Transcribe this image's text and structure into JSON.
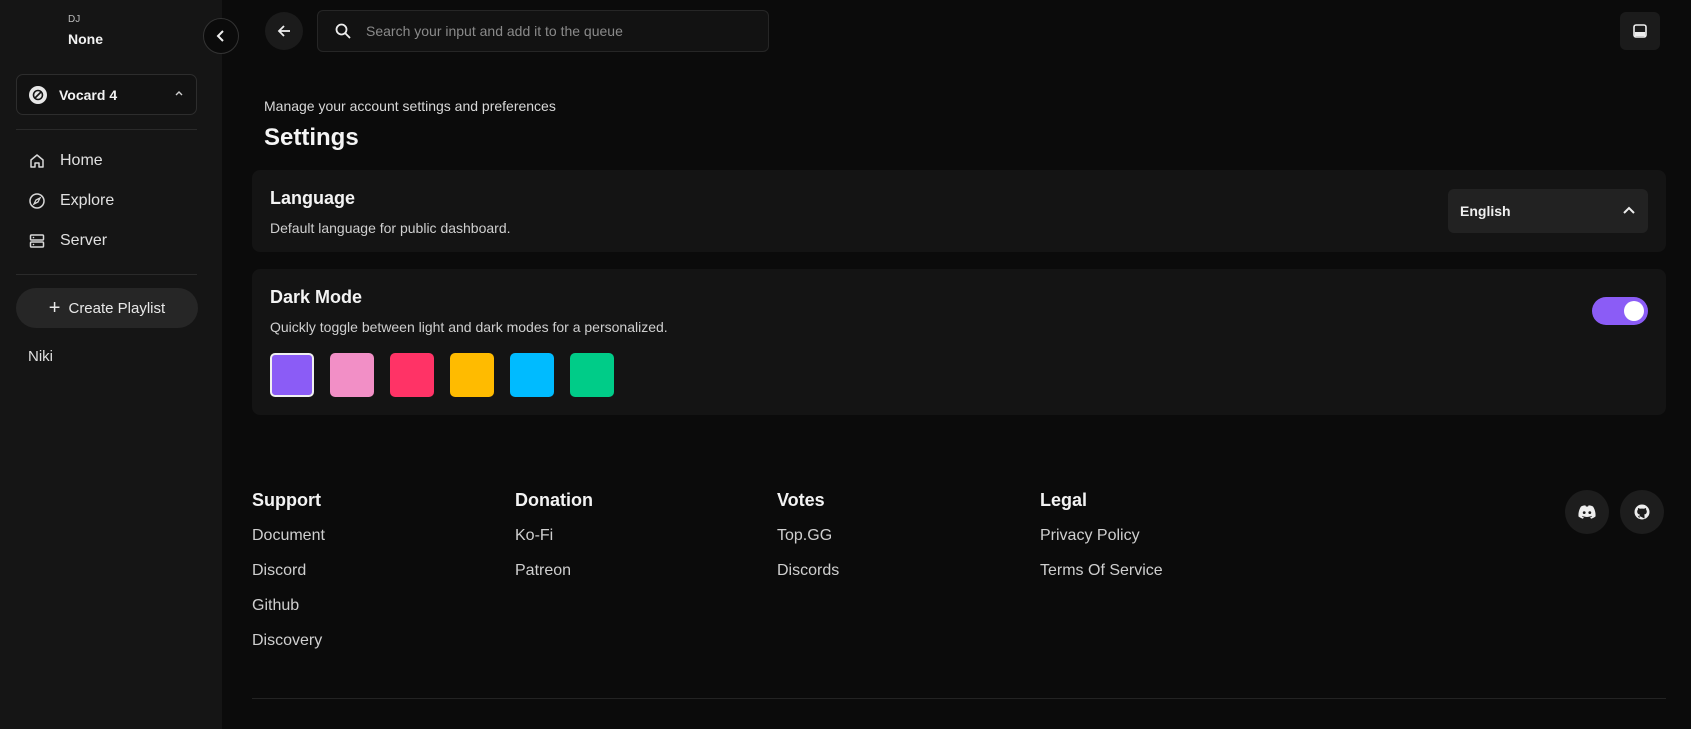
{
  "sidebar": {
    "dj_label": "DJ",
    "dj_value": "None",
    "server_name": "Vocard 4",
    "nav": [
      {
        "label": "Home",
        "icon": "home-icon"
      },
      {
        "label": "Explore",
        "icon": "compass-icon"
      },
      {
        "label": "Server",
        "icon": "server-icon"
      }
    ],
    "create_playlist": "Create Playlist",
    "playlists": [
      "Niki"
    ]
  },
  "topbar": {
    "search_placeholder": "Search your input and add it to the queue"
  },
  "header": {
    "subtitle": "Manage your account settings and preferences",
    "title": "Settings"
  },
  "language_card": {
    "title": "Language",
    "description": "Default language for public dashboard.",
    "selected": "English"
  },
  "dark_mode_card": {
    "title": "Dark Mode",
    "description": "Quickly toggle between light and dark modes for a personalized.",
    "enabled": true,
    "accent_colors": [
      "#8b5cf6",
      "#f28fc6",
      "#ff3366",
      "#ffbb00",
      "#00bbff",
      "#00cc88"
    ],
    "selected_color": "#8b5cf6"
  },
  "footer": {
    "columns": [
      {
        "heading": "Support",
        "links": [
          "Document",
          "Discord",
          "Github",
          "Discovery"
        ]
      },
      {
        "heading": "Donation",
        "links": [
          "Ko-Fi",
          "Patreon"
        ]
      },
      {
        "heading": "Votes",
        "links": [
          "Top.GG",
          "Discords"
        ]
      },
      {
        "heading": "Legal",
        "links": [
          "Privacy Policy",
          "Terms Of Service"
        ]
      }
    ],
    "social": [
      "discord-icon",
      "github-icon"
    ]
  }
}
